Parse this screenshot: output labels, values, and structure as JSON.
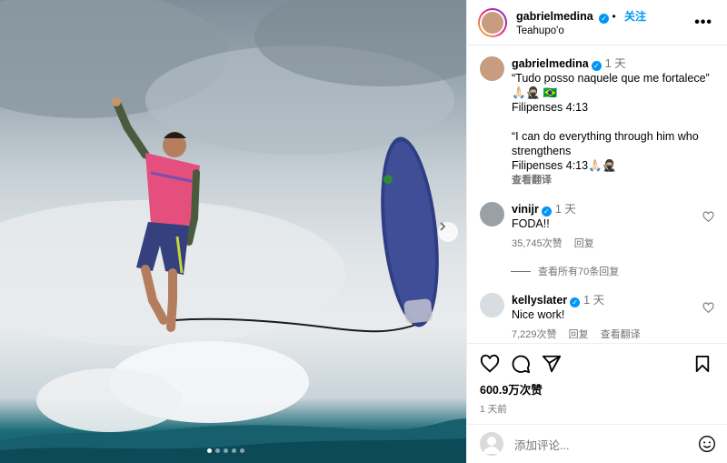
{
  "post": {
    "username": "gabrielmedina",
    "follow_label": "关注",
    "location": "Teahupo'o",
    "more_icon": "more-horizontal-icon",
    "carousel": {
      "total": 5,
      "active": 1
    }
  },
  "caption": {
    "username": "gabrielmedina",
    "time": "1 天",
    "lines": [
      "“Tudo posso naquele que me fortalece” 🙏🏻🥷🏼 🇧🇷",
      "Filipenses 4:13",
      "",
      "“I can do everything through him who strengthens",
      "Filipenses 4:13🙏🏻🥷🏼"
    ],
    "translate": "查看翻译"
  },
  "comments": [
    {
      "username": "vinijr",
      "verified": true,
      "time": "1 天",
      "text": "FODA!!",
      "likes": "35,745次赞",
      "reply": "回复",
      "translate": ""
    },
    {
      "username": "kellyslater",
      "verified": true,
      "time": "1 天",
      "text": "Nice work!",
      "likes": "7,229次赞",
      "reply": "回复",
      "translate": "查看翻译"
    }
  ],
  "view_replies": "查看所有70条回复",
  "likes_count": "600.9万次赞",
  "post_age": "1 天前",
  "add_comment_placeholder": "添加评论...",
  "colors": {
    "accent": "#0095f6",
    "muted": "#737373",
    "divider": "#efefef"
  }
}
